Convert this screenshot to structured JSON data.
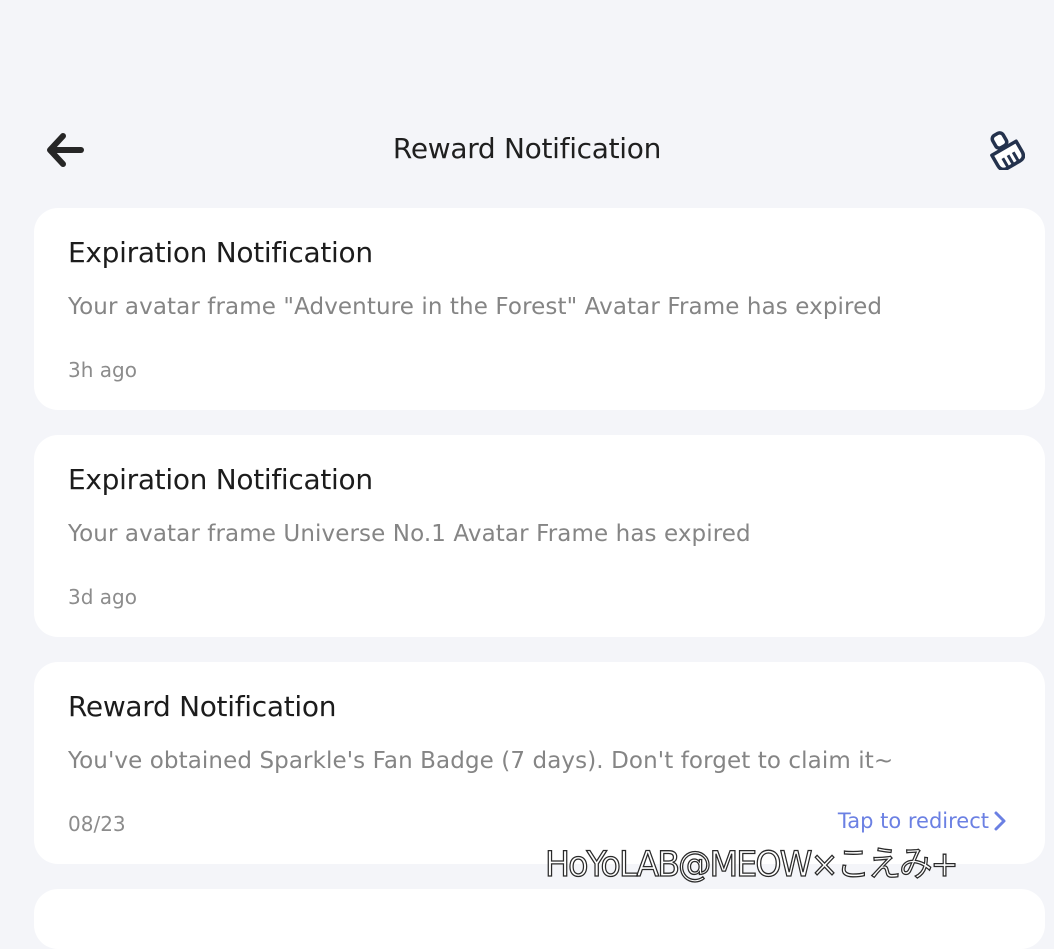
{
  "header": {
    "title": "Reward Notification",
    "back_icon": "arrow-left-icon",
    "clear_icon": "broom-icon"
  },
  "notifications": [
    {
      "title": "Expiration Notification",
      "message": "Your avatar frame \"Adventure in the Forest\" Avatar Frame has expired",
      "time": "3h ago"
    },
    {
      "title": "Expiration Notification",
      "message": "Your avatar frame Universe No.1 Avatar Frame has expired",
      "time": "3d ago"
    },
    {
      "title": "Reward Notification",
      "message": "You've obtained Sparkle's Fan Badge (7 days). Don't forget to claim it~",
      "time": "08/23",
      "action_label": "Tap to redirect"
    }
  ],
  "watermark": "HoYoLAB@MEOW×こえみ+",
  "colors": {
    "background": "#f4f5f9",
    "card": "#ffffff",
    "link": "#6b80e3",
    "title": "#1c1c1c",
    "secondary_text": "#858585"
  }
}
